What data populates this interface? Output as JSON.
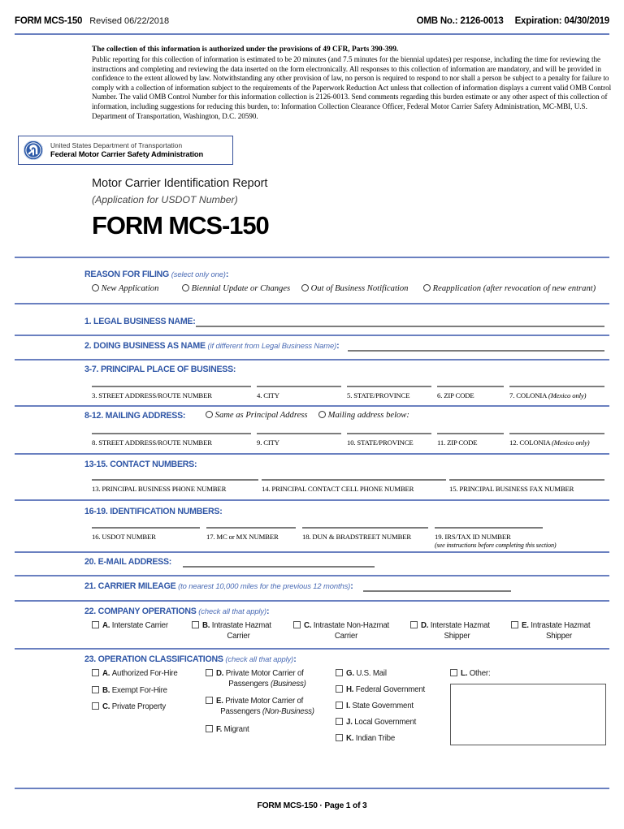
{
  "header": {
    "form_number": "FORM MCS-150",
    "revised": "Revised 06/22/2018",
    "omb": "OMB No.: 2126-0013",
    "expiration": "Expiration: 04/30/2019"
  },
  "burden": {
    "lead": "The collection of this information is authorized under the provisions of 49 CFR, Parts 390-399.",
    "body": "Public reporting for this collection of information is estimated to be 20 minutes (and 7.5 minutes for the biennial updates) per response, including the time for reviewing the instructions and completing and reviewing the data inserted on the form electronically. All responses to this collection of information are mandatory, and will be provided in confidence to the extent allowed by law. Notwithstanding any other provision of law, no person is required to respond to nor shall a person be subject to a penalty for failure to comply with a collection of information subject to the requirements of the Paperwork Reduction Act unless that collection of information displays a current valid OMB Control Number. The valid OMB Control Number for this information collection is 2126-0013. Send comments regarding this burden estimate or any other aspect of this collection of information, including suggestions for reducing this burden, to: Information Collection Clearance Officer, Federal Motor Carrier Safety Administration, MC-MBI, U.S. Department of Transportation, Washington, D.C. 20590."
  },
  "agency": {
    "line1": "United States Department of Transportation",
    "line2": "Federal Motor Carrier Safety Administration"
  },
  "title": {
    "main": "Motor Carrier Identification Report",
    "sub": "(Application for USDOT Number)",
    "form": "FORM MCS-150"
  },
  "reason": {
    "label": "REASON FOR FILING",
    "note": "(select only one)",
    "options": [
      "New Application",
      "Biennial Update or Changes",
      "Out of Business Notification",
      "Reapplication (after revocation of new entrant)"
    ]
  },
  "s1": {
    "label": "1. LEGAL BUSINESS NAME:"
  },
  "s2": {
    "label": "2. DOING BUSINESS AS NAME",
    "note": "(if different from Legal Business Name)",
    "colon": ":"
  },
  "s3_7": {
    "heading": "3-7. PRINCIPAL PLACE OF BUSINESS:",
    "fields": [
      {
        "caption": "3. STREET ADDRESS/ROUTE NUMBER",
        "note": ""
      },
      {
        "caption": "4. CITY",
        "note": ""
      },
      {
        "caption": "5. STATE/PROVINCE",
        "note": ""
      },
      {
        "caption": "6. ZIP CODE",
        "note": ""
      },
      {
        "caption": "7. COLONIA ",
        "note": "(Mexico only)"
      }
    ]
  },
  "s8_12": {
    "heading": "8-12. MAILING ADDRESS:",
    "options": [
      "Same as Principal Address",
      "Mailing address below:"
    ],
    "fields": [
      {
        "caption": "8. STREET ADDRESS/ROUTE NUMBER",
        "note": ""
      },
      {
        "caption": "9. CITY",
        "note": ""
      },
      {
        "caption": "10. STATE/PROVINCE",
        "note": ""
      },
      {
        "caption": "11. ZIP CODE",
        "note": ""
      },
      {
        "caption": "12. COLONIA ",
        "note": "(Mexico only)"
      }
    ]
  },
  "s13_15": {
    "heading": "13-15. CONTACT NUMBERS:",
    "fields": [
      "13. PRINCIPAL BUSINESS PHONE NUMBER",
      "14. PRINCIPAL CONTACT CELL PHONE NUMBER",
      "15. PRINCIPAL BUSINESS FAX NUMBER"
    ]
  },
  "s16_19": {
    "heading": "16-19. IDENTIFICATION NUMBERS:",
    "fields": [
      {
        "caption": "16. USDOT NUMBER",
        "sub": ""
      },
      {
        "caption": "17. MC or MX NUMBER",
        "sub": ""
      },
      {
        "caption": "18. DUN & BRADSTREET NUMBER",
        "sub": ""
      },
      {
        "caption": "19. IRS/TAX ID NUMBER",
        "sub": "(see instructions before completing this section)"
      }
    ]
  },
  "s20": {
    "label": "20. E-MAIL ADDRESS:"
  },
  "s21": {
    "label": "21. CARRIER MILEAGE",
    "note": "(to nearest 10,000 miles for the previous 12 months)",
    "colon": ":"
  },
  "s22": {
    "label": "22. COMPANY OPERATIONS",
    "note": "(check all that apply)",
    "colon": ":",
    "items": [
      {
        "letter": "A.",
        "line1": "Interstate Carrier",
        "line2": ""
      },
      {
        "letter": "B.",
        "line1": "Intrastate Hazmat",
        "line2": "Carrier"
      },
      {
        "letter": "C.",
        "line1": "Intrastate Non-Hazmat",
        "line2": "Carrier"
      },
      {
        "letter": "D.",
        "line1": "Interstate Hazmat",
        "line2": "Shipper"
      },
      {
        "letter": "E.",
        "line1": "Intrastate Hazmat",
        "line2": "Shipper"
      }
    ]
  },
  "s23": {
    "label": "23. OPERATION CLASSIFICATIONS",
    "note": "(check all that apply)",
    "colon": ":",
    "col1": [
      {
        "letter": "A.",
        "line1": "Authorized For-Hire"
      },
      {
        "letter": "B.",
        "line1": "Exempt For-Hire"
      },
      {
        "letter": "C.",
        "line1": "Private Property"
      }
    ],
    "col2": [
      {
        "letter": "D.",
        "line1": "Private Motor Carrier of",
        "line2": "Passengers ",
        "line2_italic": "(Business)"
      },
      {
        "letter": "E.",
        "line1": "Private Motor Carrier of",
        "line2": "Passengers ",
        "line2_italic": "(Non-Business)"
      },
      {
        "letter": "F.",
        "line1": "Migrant",
        "line2": "",
        "line2_italic": ""
      }
    ],
    "col3": [
      {
        "letter": "G.",
        "line1": "U.S. Mail"
      },
      {
        "letter": "H.",
        "line1": "Federal Government"
      },
      {
        "letter": "I.",
        "line1": "State Government"
      },
      {
        "letter": "J.",
        "line1": "Local Government"
      },
      {
        "letter": "K.",
        "line1": "Indian Tribe"
      }
    ],
    "col4": [
      {
        "letter": "L.",
        "line1": "Other:"
      }
    ]
  },
  "footer": {
    "text": "FORM MCS-150 · Page 1 of 3"
  },
  "colors": {
    "header_blue": "#2f56a6",
    "rule_blue": "#6a80c0",
    "seal_blue": "#2d5aa8",
    "line_gray": "#7c7c7c"
  }
}
